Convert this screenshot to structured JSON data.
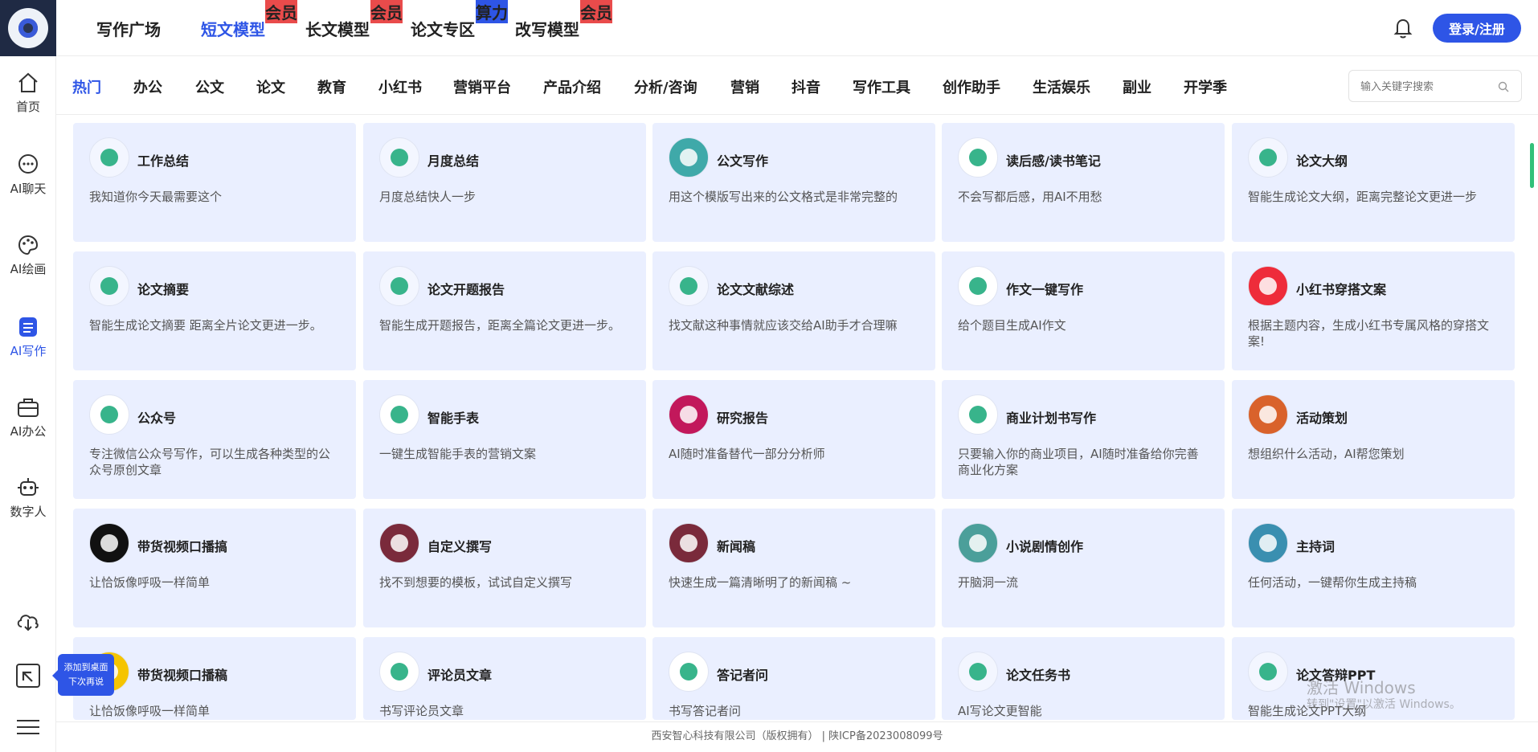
{
  "sidebar": {
    "items": [
      {
        "label": "首页",
        "icon": "home-icon"
      },
      {
        "label": "AI聊天",
        "icon": "chat-icon"
      },
      {
        "label": "AI绘画",
        "icon": "palette-icon"
      },
      {
        "label": "AI写作",
        "icon": "document-icon"
      },
      {
        "label": "AI办公",
        "icon": "briefcase-icon"
      },
      {
        "label": "数字人",
        "icon": "robot-icon"
      }
    ],
    "tooltip": {
      "line1": "添加到桌面",
      "line2": "下次再说"
    }
  },
  "header": {
    "tabs": [
      {
        "label": "写作广场",
        "badge": ""
      },
      {
        "label": "短文模型",
        "badge": "会员"
      },
      {
        "label": "长文模型",
        "badge": "会员"
      },
      {
        "label": "论文专区",
        "badge": "算力"
      },
      {
        "label": "改写模型",
        "badge": "会员"
      }
    ],
    "login_label": "登录/注册"
  },
  "categories": {
    "items": [
      "热门",
      "办公",
      "公文",
      "论文",
      "教育",
      "小红书",
      "营销平台",
      "产品介绍",
      "分析/咨询",
      "营销",
      "抖音",
      "写作工具",
      "创作助手",
      "生活娱乐",
      "副业",
      "开学季"
    ],
    "search_placeholder": "输入关键字搜索"
  },
  "cards": [
    {
      "title": "工作总结",
      "desc": "我知道你今天最需要这个"
    },
    {
      "title": "月度总结",
      "desc": "月度总结快人一步"
    },
    {
      "title": "公文写作",
      "desc": "用这个模版写出来的公文格式是非常完整的"
    },
    {
      "title": "读后感/读书笔记",
      "desc": "不会写都后感，用AI不用愁"
    },
    {
      "title": "论文大纲",
      "desc": "智能生成论文大纲，距离完整论文更进一步"
    },
    {
      "title": "论文摘要",
      "desc": "智能生成论文摘要 距离全片论文更进一步。"
    },
    {
      "title": "论文开题报告",
      "desc": "智能生成开题报告，距离全篇论文更进一步。"
    },
    {
      "title": "论文文献综述",
      "desc": "找文献这种事情就应该交给AI助手才合理嘛"
    },
    {
      "title": "作文一键写作",
      "desc": "给个题目生成AI作文"
    },
    {
      "title": "小红书穿搭文案",
      "desc": "根据主题内容，生成小红书专属风格的穿搭文案!"
    },
    {
      "title": "公众号",
      "desc": "专注微信公众号写作，可以生成各种类型的公众号原创文章"
    },
    {
      "title": "智能手表",
      "desc": "一键生成智能手表的营销文案"
    },
    {
      "title": "研究报告",
      "desc": "AI随时准备替代一部分分析师"
    },
    {
      "title": "商业计划书写作",
      "desc": "只要输入你的商业项目，AI随时准备给你完善商业化方案"
    },
    {
      "title": "活动策划",
      "desc": "想组织什么活动，AI帮您策划"
    },
    {
      "title": "带货视频口播搞",
      "desc": "让恰饭像呼吸一样简单"
    },
    {
      "title": "自定义撰写",
      "desc": "找不到想要的模板，试试自定义撰写"
    },
    {
      "title": "新闻稿",
      "desc": "快速生成一篇清晰明了的新闻稿 ~"
    },
    {
      "title": "小说剧情创作",
      "desc": "开脑洞一流"
    },
    {
      "title": "主持词",
      "desc": "任何活动，一键帮你生成主持稿"
    },
    {
      "title": "带货视频口播稿",
      "desc": "让恰饭像呼吸一样简单"
    },
    {
      "title": "评论员文章",
      "desc": "书写评论员文章"
    },
    {
      "title": "答记者问",
      "desc": "书写答记者问"
    },
    {
      "title": "论文任务书",
      "desc": "AI写论文更智能"
    },
    {
      "title": "论文答辩PPT",
      "desc": "智能生成论文PPT大纲"
    }
  ],
  "footer": {
    "text": "西安智心科技有限公司（版权拥有）  | 陕ICP备2023008099号"
  },
  "watermark": {
    "line1": "激活 Windows",
    "line2": "转到\"设置\"以激活 Windows。"
  },
  "colors": {
    "accent": "#2e55e6",
    "card_bg": "#eaefff",
    "badge_red": "#e94b4b",
    "badge_blue": "#2e55e6"
  }
}
